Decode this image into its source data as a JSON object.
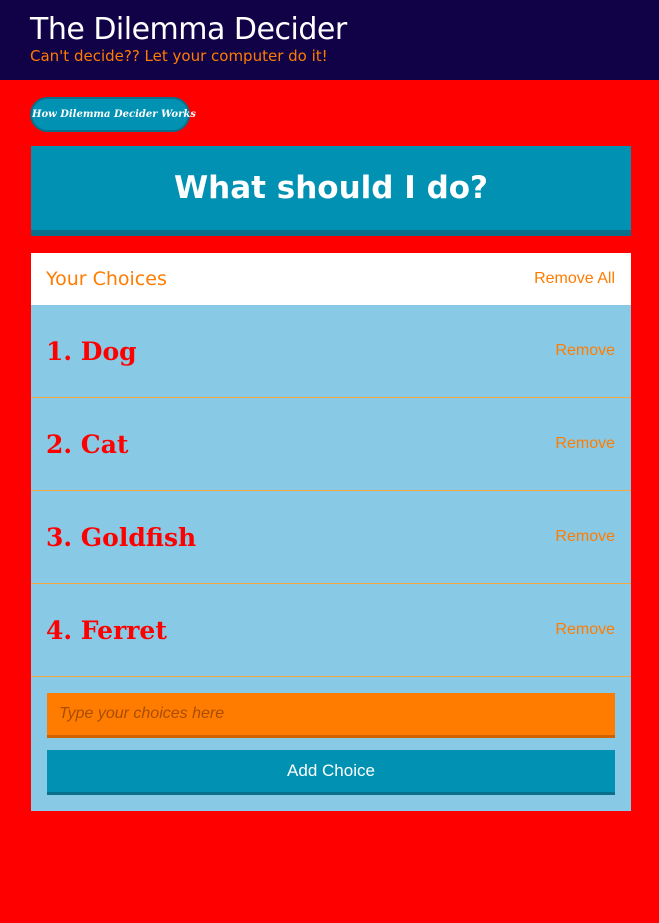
{
  "header": {
    "title": "The Dilemma Decider",
    "subtitle": "Can't decide?? Let your computer do it!"
  },
  "actions": {
    "how_it_works": "How Dilemma Decider Works",
    "decide": "What should I do?"
  },
  "choices": {
    "heading": "Your Choices",
    "remove_all": "Remove All",
    "items": [
      {
        "label": "1. Dog",
        "remove": "Remove"
      },
      {
        "label": "2. Cat",
        "remove": "Remove"
      },
      {
        "label": "3. Goldfish",
        "remove": "Remove"
      },
      {
        "label": "4. Ferret",
        "remove": "Remove"
      }
    ]
  },
  "form": {
    "input_value": "",
    "placeholder": "Type your choices here",
    "add_label": "Add Choice"
  },
  "colors": {
    "page_background": "#ff0000",
    "header_background": "#110147",
    "accent_orange": "#ff7c00",
    "accent_blue": "#0091b3",
    "panel_blue": "#88cae6",
    "choice_text": "#ff0000"
  }
}
